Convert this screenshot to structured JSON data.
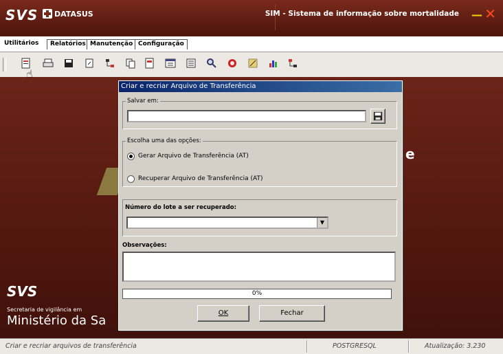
{
  "window": {
    "svs_logo": "SVS",
    "datasus_logo": "DATASUS",
    "title": "SIM - Sistema de informação sobre mortalidade"
  },
  "menu": [
    "Utilitários",
    "Relatórios",
    "Manutenção",
    "Configuração"
  ],
  "background": {
    "svs": "SVS",
    "secretaria": "Secretaria de vigilância em",
    "ministerio": "Ministério da Sa",
    "partial_letter": "e"
  },
  "dialog": {
    "title": "Criar e recriar Arquivo de Transferência",
    "save_legend": "Salvar em:",
    "save_value": "",
    "options_legend": "Escolha uma das opções:",
    "option_generate": "Gerar Arquivo de Transferência (AT)",
    "option_recover": "Recuperar Arquivo de Transferência (AT)",
    "selected_option": "generate",
    "lote_label": "Número do lote a ser recuperado:",
    "lote_value": "",
    "obs_label": "Observações:",
    "obs_value": "",
    "progress_text": "0%",
    "progress": 0,
    "ok_label": "OK",
    "close_label": "Fechar"
  },
  "status": {
    "message": "Criar e recriar arquivos de transferência",
    "db": "POSTGRESQL",
    "update": "Atualização: 3.230"
  }
}
